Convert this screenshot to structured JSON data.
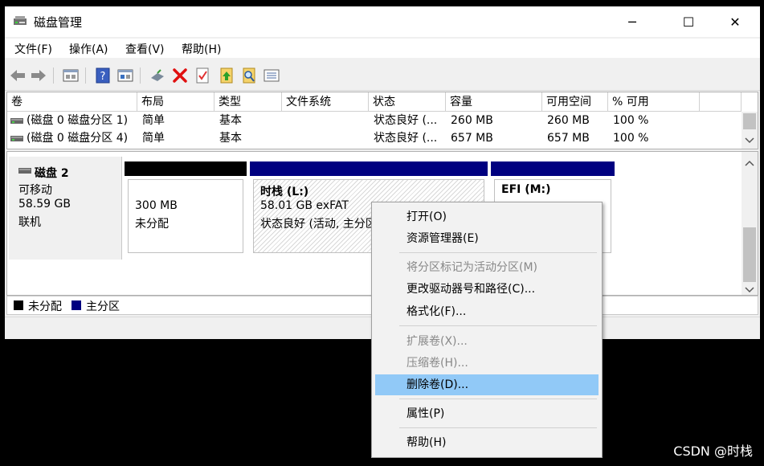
{
  "window": {
    "title": "磁盘管理",
    "minimize": "─",
    "maximize": "☐",
    "close": "✕"
  },
  "menubar": [
    "文件(F)",
    "操作(A)",
    "查看(V)",
    "帮助(H)"
  ],
  "toolbar": {
    "icons": [
      "back-icon",
      "forward-icon",
      "properties-icon",
      "help-icon",
      "show-hide-icon",
      "connect-icon",
      "delete-icon",
      "check-icon",
      "up-folder-icon",
      "search-folder-icon",
      "list-view-icon"
    ]
  },
  "volume_table": {
    "columns": [
      "卷",
      "布局",
      "类型",
      "文件系统",
      "状态",
      "容量",
      "可用空间",
      "% 可用"
    ],
    "rows": [
      [
        "(磁盘 0 磁盘分区 1)",
        "简单",
        "基本",
        "",
        "状态良好 (...",
        "260 MB",
        "260 MB",
        "100 %"
      ],
      [
        "(磁盘 0 磁盘分区 4)",
        "简单",
        "基本",
        "",
        "状态良好 (...",
        "657 MB",
        "657 MB",
        "100 %"
      ]
    ]
  },
  "disk": {
    "name": "磁盘 2",
    "type": "可移动",
    "size": "58.59 GB",
    "status": "联机"
  },
  "partitions": [
    {
      "line1": "300 MB",
      "line2": "未分配",
      "bar_color": "#000000"
    },
    {
      "title": "时栈  (L:)",
      "line1": "58.01 GB exFAT",
      "line2": "状态良好 (活动, 主分区)",
      "bar_color": "#000080"
    },
    {
      "title": "EFI  (M:)",
      "line1": "",
      "line2": "",
      "bar_color": "#000080"
    }
  ],
  "legend": [
    {
      "label": "未分配",
      "color": "#000000"
    },
    {
      "label": "主分区",
      "color": "#000080"
    }
  ],
  "context_menu": {
    "items": [
      {
        "label": "打开(O)",
        "enabled": true
      },
      {
        "label": "资源管理器(E)",
        "enabled": true
      },
      {
        "label": "将分区标记为活动分区(M)",
        "enabled": false
      },
      {
        "label": "更改驱动器号和路径(C)...",
        "enabled": true
      },
      {
        "label": "格式化(F)...",
        "enabled": true
      },
      {
        "label": "扩展卷(X)...",
        "enabled": false
      },
      {
        "label": "压缩卷(H)...",
        "enabled": false
      },
      {
        "label": "删除卷(D)...",
        "enabled": true,
        "highlighted": true
      },
      {
        "label": "属性(P)",
        "enabled": true
      },
      {
        "label": "帮助(H)",
        "enabled": true
      }
    ]
  },
  "watermark": "CSDN @时栈"
}
